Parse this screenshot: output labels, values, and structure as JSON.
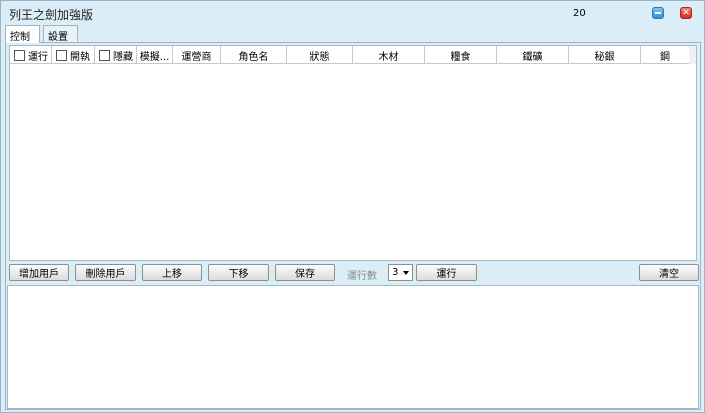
{
  "window": {
    "title": "列王之劍加強版",
    "counter": "20",
    "minimize_icon": "minimize-icon",
    "close_icon": "close-icon",
    "close_glyph": "✕"
  },
  "tabs": [
    {
      "label": "控制",
      "active": true
    },
    {
      "label": "設置",
      "active": false
    }
  ],
  "grid": {
    "columns": [
      {
        "label": "運行",
        "checkbox": true
      },
      {
        "label": "開執",
        "checkbox": true
      },
      {
        "label": "隱藏",
        "checkbox": true
      },
      {
        "label": "模擬...",
        "checkbox": false
      },
      {
        "label": "運營商",
        "checkbox": false
      },
      {
        "label": "角色名",
        "checkbox": false
      },
      {
        "label": "狀態",
        "checkbox": false
      },
      {
        "label": "木材",
        "checkbox": false
      },
      {
        "label": "糧食",
        "checkbox": false
      },
      {
        "label": "鐵礦",
        "checkbox": false
      },
      {
        "label": "秘銀",
        "checkbox": false
      },
      {
        "label": "鋼",
        "checkbox": false
      }
    ],
    "rows": []
  },
  "toolbar": {
    "add_user": "增加用戶",
    "delete_user": "刪除用戶",
    "move_up": "上移",
    "move_down": "下移",
    "save": "保存",
    "run_count_label": "運行數",
    "run_count_value": "3",
    "run": "運行",
    "clear": "清空"
  },
  "log": {
    "content": ""
  }
}
